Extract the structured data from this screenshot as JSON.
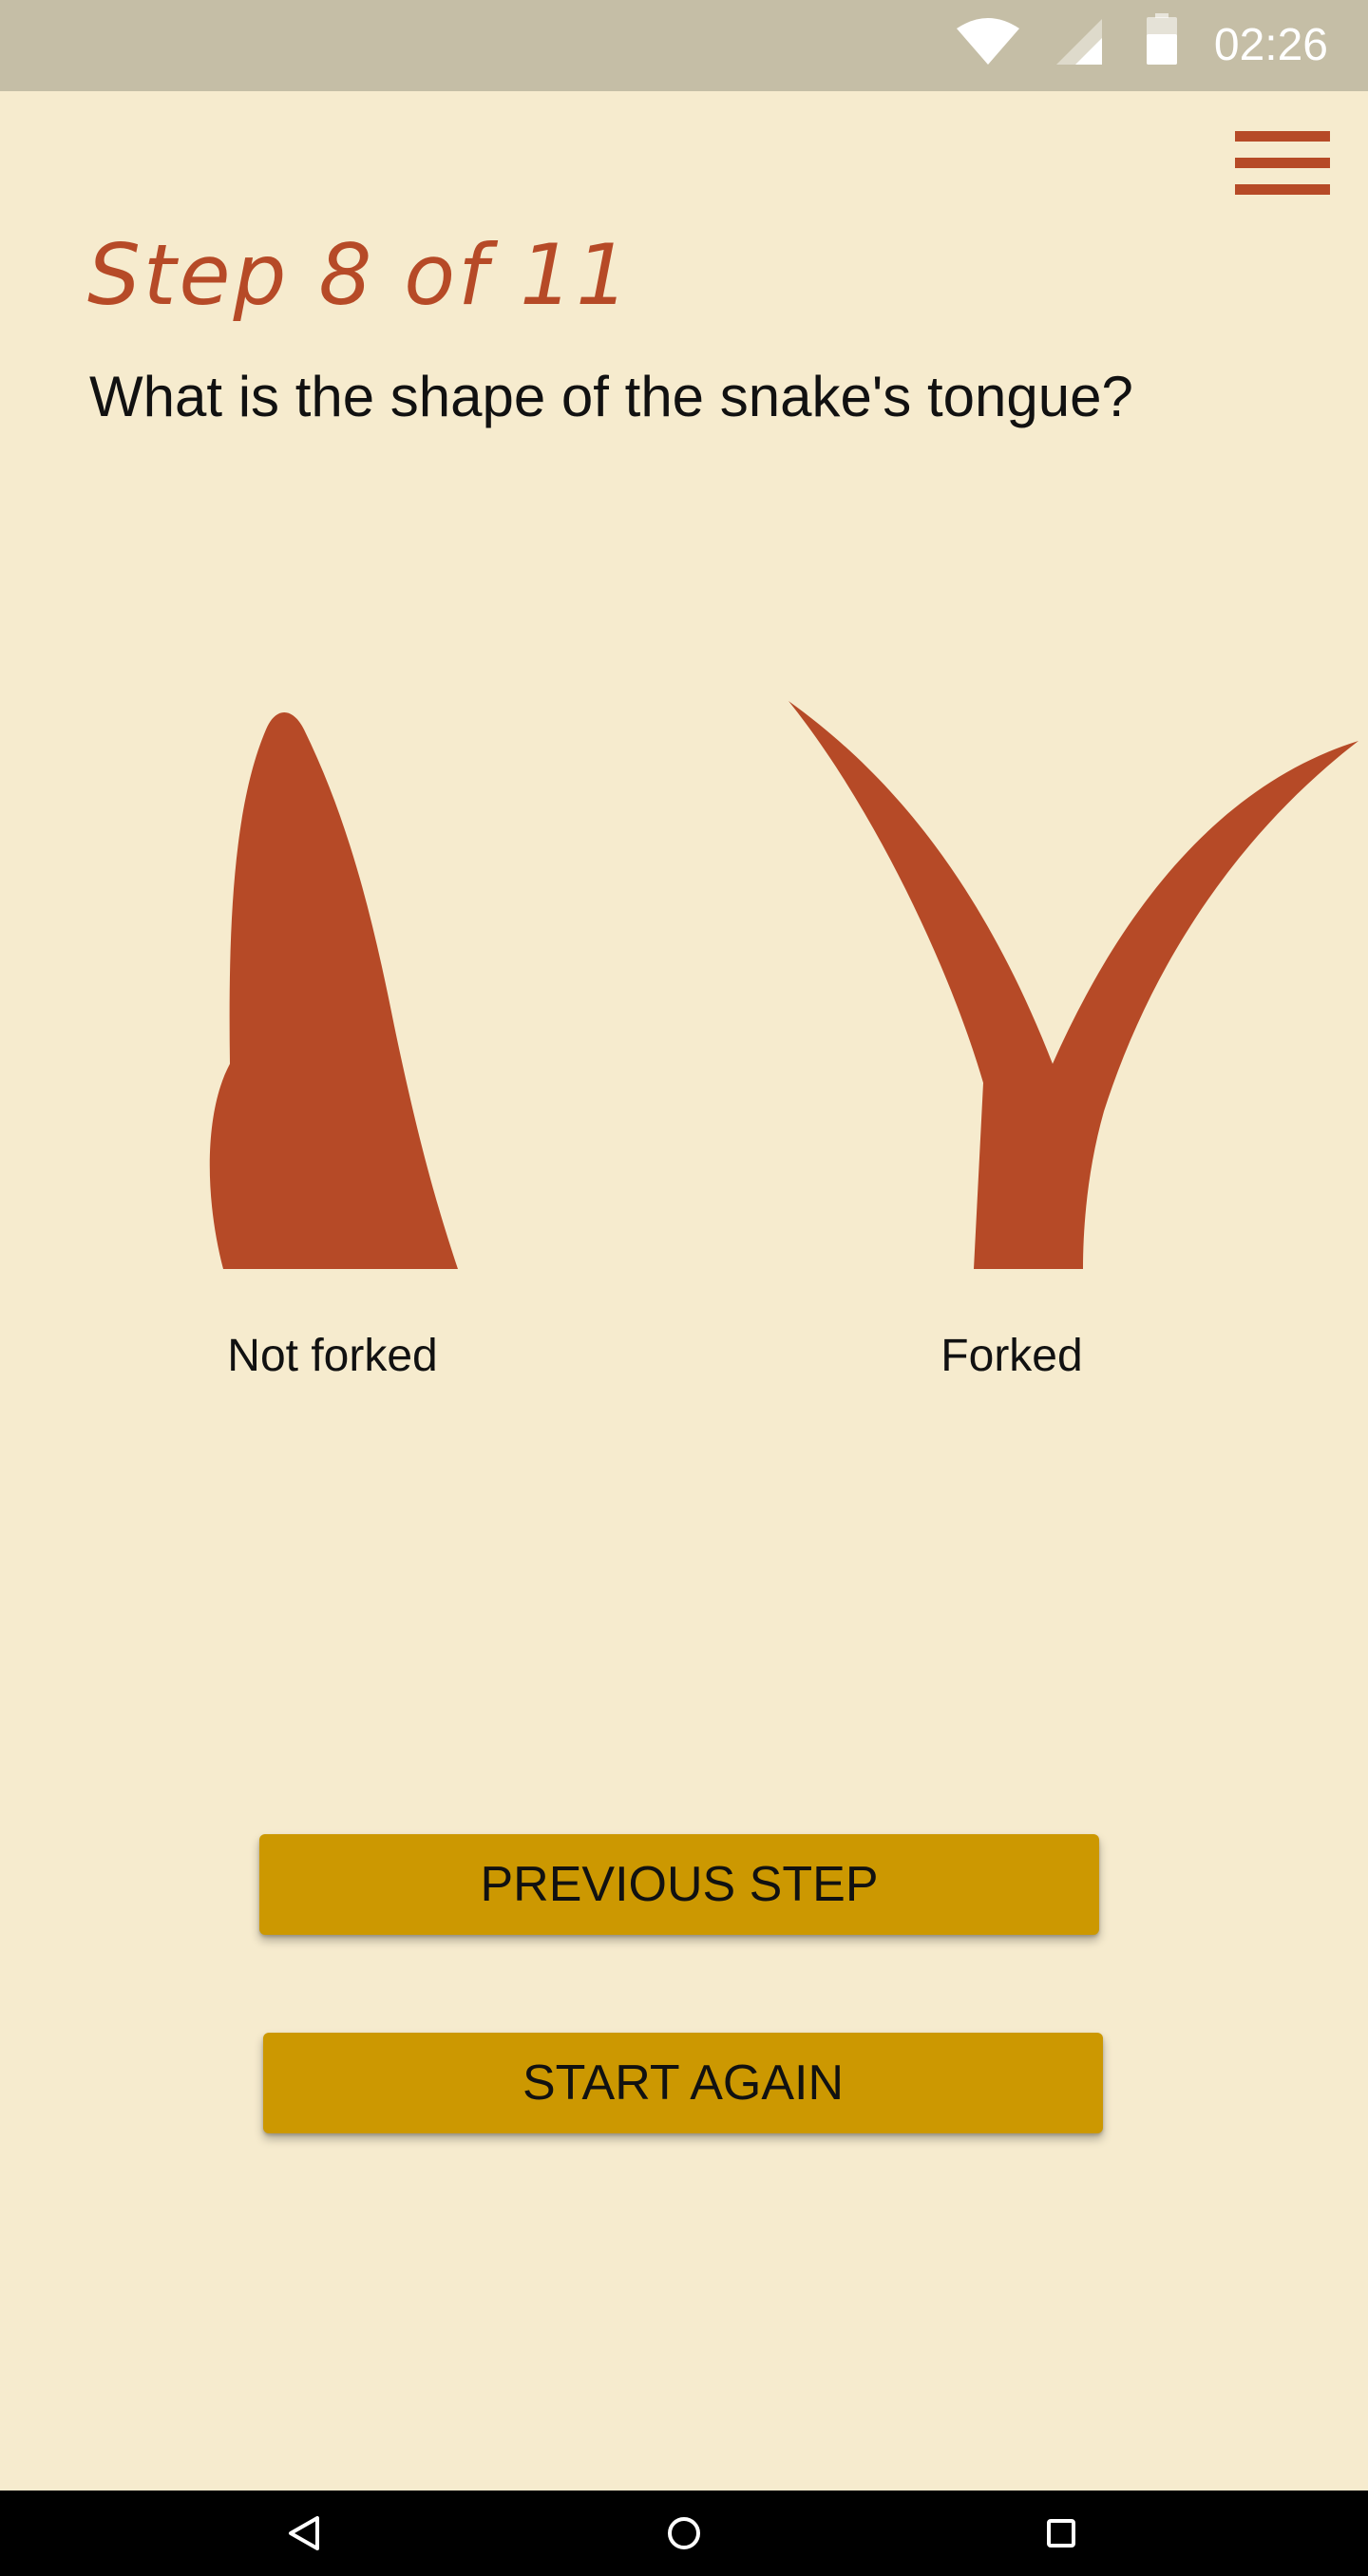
{
  "status_bar": {
    "time": "02:26",
    "icons": [
      "wifi-icon",
      "cell-signal-icon",
      "battery-icon"
    ]
  },
  "header": {
    "menu_icon": "hamburger-menu-icon",
    "step_title": "Step 8 of 11"
  },
  "question": "What is the shape of the snake's tongue?",
  "options": [
    {
      "label": "Not forked",
      "icon": "tongue-not-forked-illustration"
    },
    {
      "label": "Forked",
      "icon": "tongue-forked-illustration"
    }
  ],
  "buttons": {
    "previous_label": "PREVIOUS STEP",
    "start_again_label": "START AGAIN"
  },
  "nav_bar": {
    "icons": [
      "back-icon",
      "home-icon",
      "recents-icon"
    ]
  },
  "colors": {
    "background": "#f6ebce",
    "accent": "#b64a27",
    "button": "#cc9801",
    "status_bar": "#c5bea6"
  }
}
